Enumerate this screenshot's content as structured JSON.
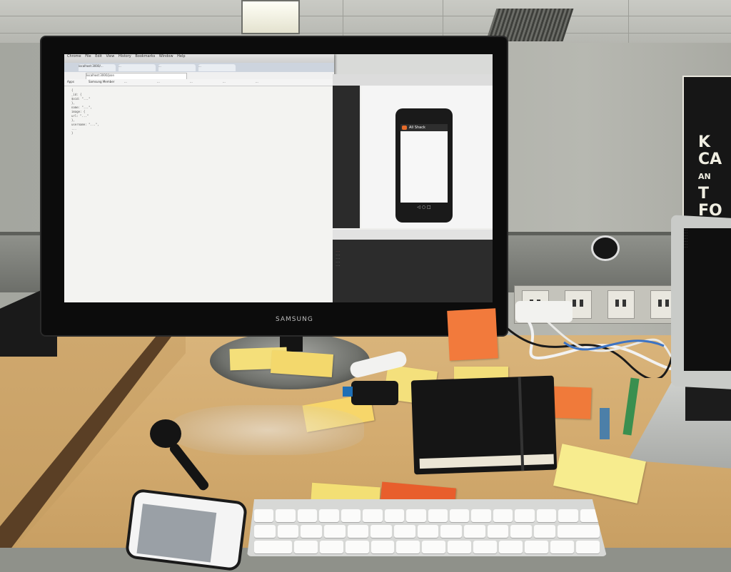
{
  "scene": {
    "description_tags": [
      "desk",
      "monitor",
      "laptop",
      "notebook",
      "sticky-notes",
      "keyboard",
      "phone"
    ],
    "colors": {
      "desk": "#d3ab6f",
      "wall": "#a9aba4",
      "monitor_bezel": "#0c0c0c",
      "sticky_yellow": "#f4df7a",
      "sticky_orange": "#f27a3c",
      "app_accent": "#e66b2a"
    }
  },
  "monitor": {
    "brand": "SAMSUNG"
  },
  "browser": {
    "menu": [
      "Chrome",
      "File",
      "Edit",
      "View",
      "History",
      "Bookmarks",
      "Window",
      "Help"
    ],
    "tabs": [
      "localhost:3000/...",
      "...",
      "...",
      "..."
    ],
    "address": "localhost:3000/json",
    "bookmarks": [
      "Apps",
      "Samsung Member",
      "...",
      "...",
      "...",
      "...",
      "..."
    ],
    "json_lines": [
      "{",
      "  _id: {",
      "    $oid: \"...\"",
      "  },",
      "  name: \"...\",",
      "  image: {",
      "    url: \"...\"",
      "  },",
      "  username: \"...\",",
      "  ...",
      "}"
    ]
  },
  "ide": {
    "preview_app_title": "All Shack",
    "phone_nav_glyphs": "◁  ○  □",
    "console_lines": [
      "...",
      "...",
      "...",
      "...",
      "..."
    ]
  },
  "poster": {
    "lines": [
      "K",
      "CA",
      "AN",
      "T",
      "FO"
    ]
  },
  "laptop": {
    "terminal_lines": [
      "...",
      "...",
      "...",
      "...",
      "...",
      "...",
      "..."
    ]
  }
}
